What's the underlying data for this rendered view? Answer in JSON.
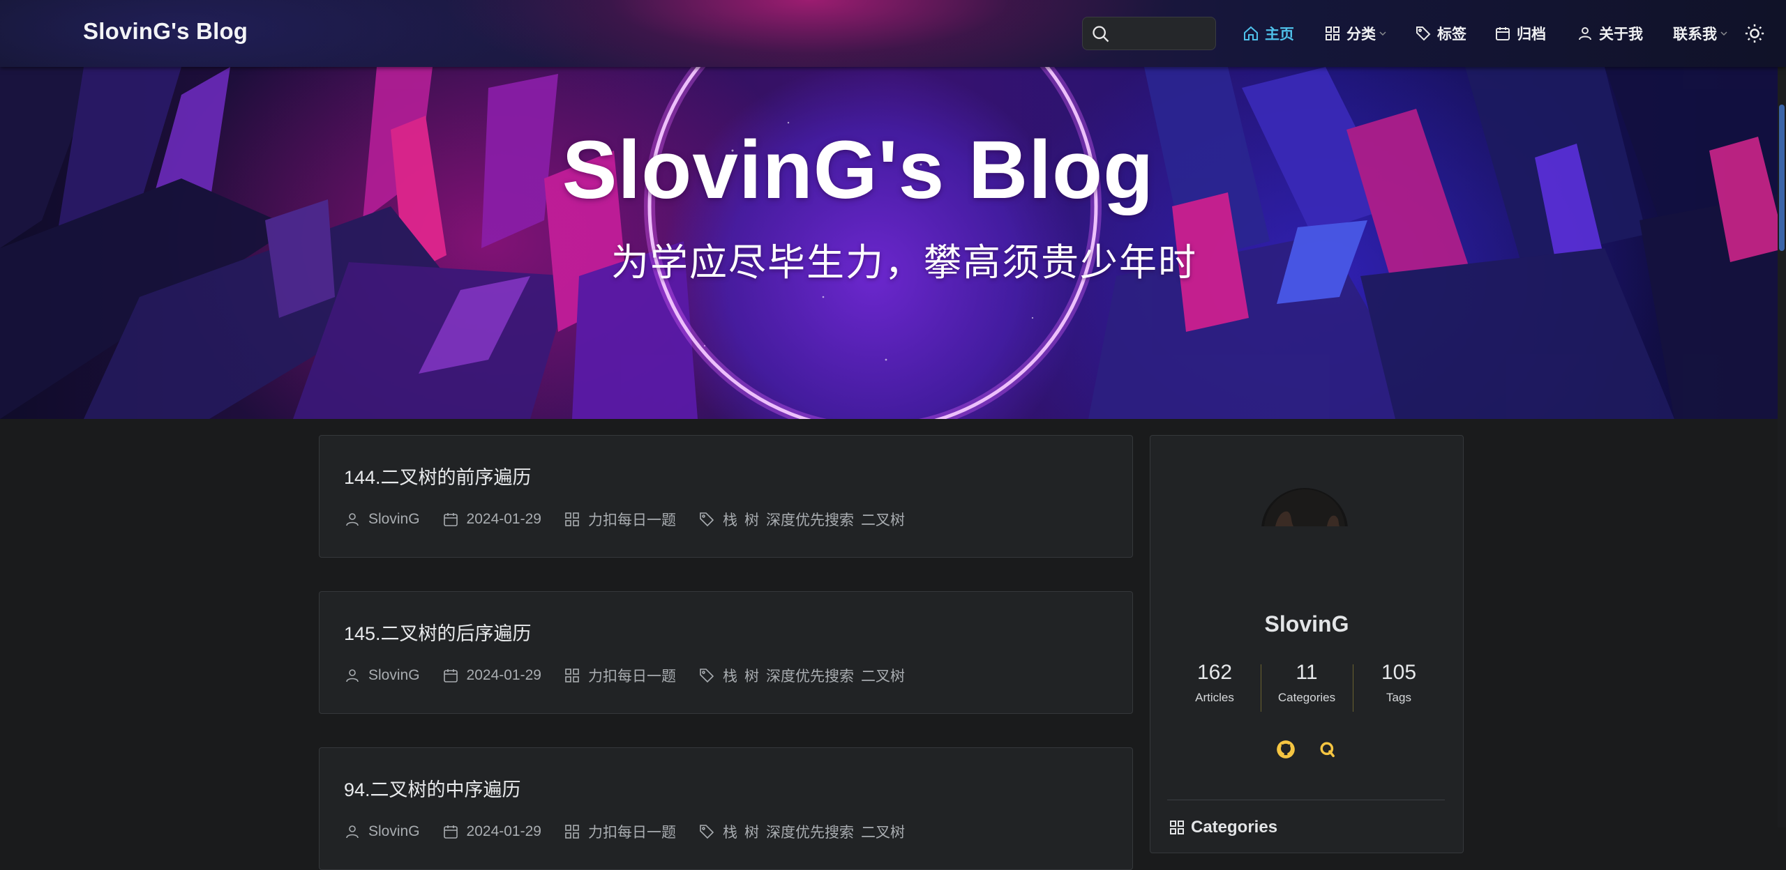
{
  "brand": "SlovinG's Blog",
  "search": {
    "placeholder": ""
  },
  "nav": [
    {
      "label": "主页",
      "icon": "home-icon",
      "active": true
    },
    {
      "label": "分类",
      "icon": "grid-icon",
      "dropdown": true
    },
    {
      "label": "标签",
      "icon": "tag-icon"
    },
    {
      "label": "归档",
      "icon": "calendar-icon"
    },
    {
      "label": "关于我",
      "icon": "user-icon"
    },
    {
      "label": "联系我",
      "icon": "",
      "dropdown": true
    }
  ],
  "theme_toggle": {
    "icon": "sun-icon"
  },
  "hero": {
    "title": "SlovinG's Blog",
    "subtitle": "为学应尽毕生力，攀高须贵少年时"
  },
  "posts": [
    {
      "title": "144.二叉树的前序遍历",
      "author": "SlovinG",
      "date": "2024-01-29",
      "category": "力扣每日一题",
      "tags": [
        "栈",
        "树",
        "深度优先搜索",
        "二叉树"
      ]
    },
    {
      "title": "145.二叉树的后序遍历",
      "author": "SlovinG",
      "date": "2024-01-29",
      "category": "力扣每日一题",
      "tags": [
        "栈",
        "树",
        "深度优先搜索",
        "二叉树"
      ]
    },
    {
      "title": "94.二叉树的中序遍历",
      "author": "SlovinG",
      "date": "2024-01-29",
      "category": "力扣每日一题",
      "tags": [
        "栈",
        "树",
        "深度优先搜索",
        "二叉树"
      ]
    }
  ],
  "sidebar": {
    "author_name": "SlovinG",
    "stats": [
      {
        "value": "162",
        "label": "Articles"
      },
      {
        "value": "11",
        "label": "Categories"
      },
      {
        "value": "105",
        "label": "Tags"
      }
    ],
    "social": [
      "github-icon",
      "qq-icon"
    ],
    "section_title": "Categories"
  },
  "colors": {
    "accent": "#4fc1ea",
    "social": "#f5c542",
    "background": "#1a1b1c",
    "card": "#212325"
  }
}
